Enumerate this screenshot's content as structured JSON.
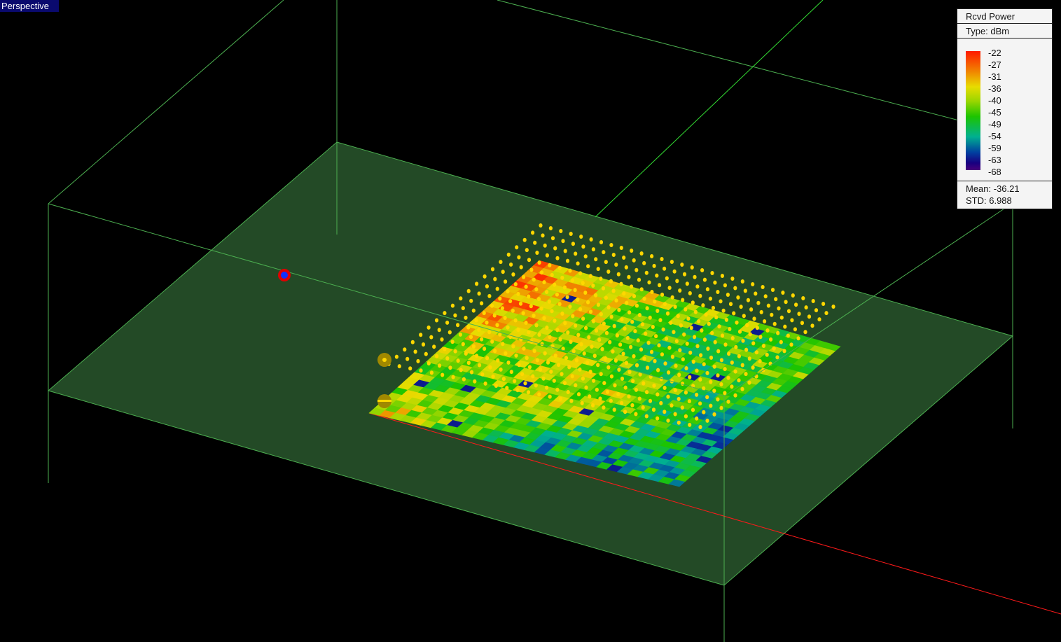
{
  "view": {
    "label": "Perspective"
  },
  "legend": {
    "title": "Rcvd Power",
    "type": "Type: dBm",
    "ticks": [
      "-22",
      "-27",
      "-31",
      "-36",
      "-40",
      "-45",
      "-49",
      "-54",
      "-59",
      "-63",
      "-68"
    ],
    "mean": "Mean: -36.21",
    "std": "STD: 6.988"
  },
  "colors": {
    "floor": "#234a26",
    "edge": "#4caf50",
    "axis_x": "#ff0000",
    "axis_y": "#33dd33",
    "receiver": "#ffd700",
    "transmitter_ring": "#e00000",
    "transmitter_core": "#1030ff"
  },
  "power_range_dbm": [
    -68,
    -22
  ]
}
